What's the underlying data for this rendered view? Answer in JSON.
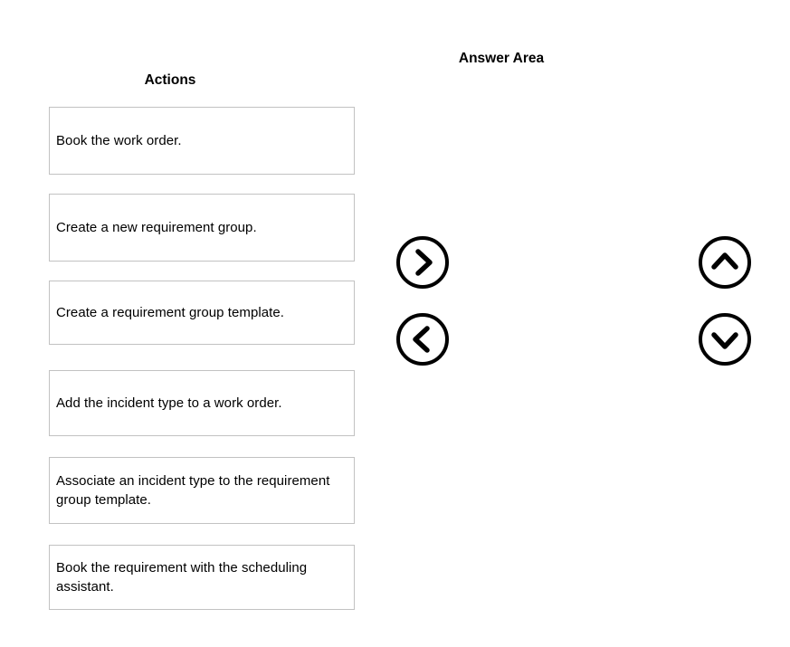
{
  "headings": {
    "actions": "Actions",
    "answer_area": "Answer Area"
  },
  "actions": {
    "items": [
      {
        "label": "Book the work order."
      },
      {
        "label": "Create a new requirement group."
      },
      {
        "label": "Create a requirement group template."
      },
      {
        "label": "Add the incident type to a work order."
      },
      {
        "label": "Associate an incident type to the requirement group template."
      },
      {
        "label": "Book the requirement with the scheduling assistant."
      }
    ]
  },
  "answer_area": {
    "items": []
  },
  "controls": {
    "move_right": {
      "icon": "chevron-right-circle-icon",
      "title": "Move right"
    },
    "move_left": {
      "icon": "chevron-left-circle-icon",
      "title": "Move left"
    },
    "move_up": {
      "icon": "chevron-up-circle-icon",
      "title": "Move up"
    },
    "move_down": {
      "icon": "chevron-down-circle-icon",
      "title": "Move down"
    }
  },
  "colors": {
    "background": "#ffffff",
    "card_border": "#c2c2c2",
    "text": "#000000",
    "icon_stroke": "#000000"
  }
}
